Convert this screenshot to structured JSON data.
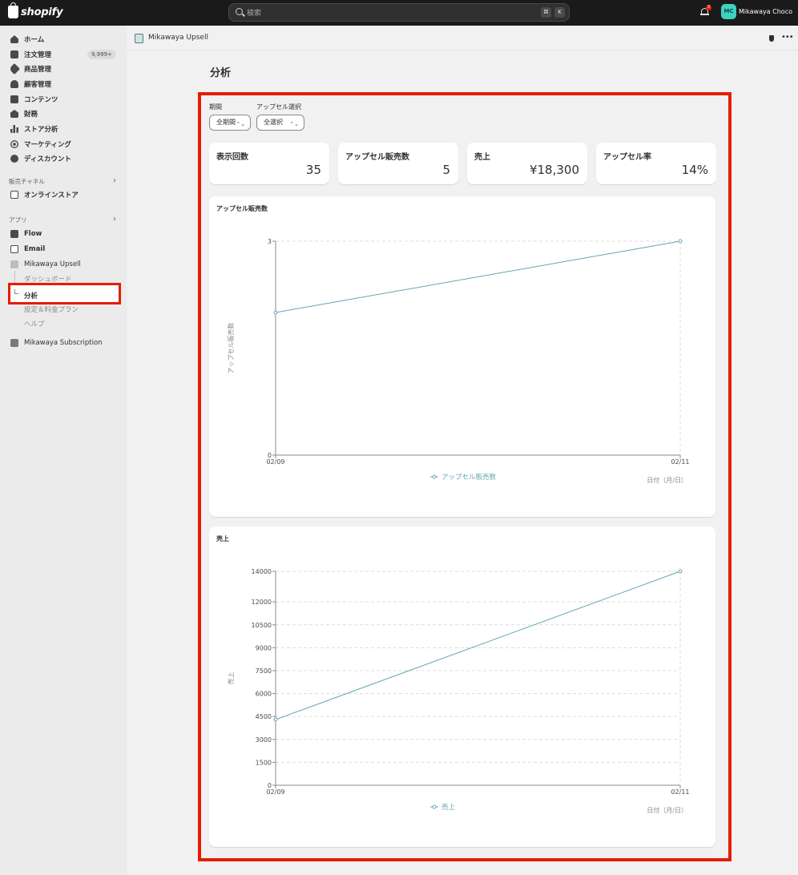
{
  "topbar": {
    "brand": "shopify",
    "search_placeholder": "検索",
    "kbd_cmd": "⌘",
    "kbd_k": "K",
    "notification_count": "3",
    "avatar_initials": "MC",
    "user_name": "Mikawaya Choco"
  },
  "sidebar": {
    "items": [
      {
        "label": "ホーム",
        "icon": "home-icon"
      },
      {
        "label": "注文管理",
        "icon": "orders-icon",
        "badge": "9,999+"
      },
      {
        "label": "商品管理",
        "icon": "tag-icon"
      },
      {
        "label": "顧客管理",
        "icon": "person-icon"
      },
      {
        "label": "コンテンツ",
        "icon": "content-icon"
      },
      {
        "label": "財務",
        "icon": "bank-icon"
      },
      {
        "label": "ストア分析",
        "icon": "bar-chart-icon"
      },
      {
        "label": "マーケティング",
        "icon": "target-icon"
      },
      {
        "label": "ディスカウント",
        "icon": "discount-icon"
      }
    ],
    "sales_channels_label": "販売チャネル",
    "online_store_label": "オンラインストア",
    "apps_label": "アプリ",
    "apps": [
      {
        "label": "Flow"
      },
      {
        "label": "Email"
      },
      {
        "label": "Mikawaya Upsell"
      }
    ],
    "upsell_sub": {
      "dashboard": "ダッシュボード",
      "analytics": "分析",
      "settings": "設定＆料金プラン",
      "help": "ヘルプ"
    },
    "subscription_label": "Mikawaya Subscription"
  },
  "main": {
    "app_name": "Mikawaya Upsell",
    "page_title": "分析",
    "filters": {
      "period_label": "期間",
      "period_value": "全期間",
      "upsell_label": "アップセル選択",
      "upsell_value": "全選択"
    },
    "kpis": [
      {
        "label": "表示回数",
        "value": "35"
      },
      {
        "label": "アップセル販売数",
        "value": "5"
      },
      {
        "label": "売上",
        "value": "¥18,300"
      },
      {
        "label": "アップセル率",
        "value": "14%"
      }
    ]
  },
  "colors": {
    "accent_line": "#5fa8b0",
    "highlight": "#e51c00",
    "avatar": "#3fd0c0"
  },
  "chart_data": [
    {
      "type": "line",
      "title": "アップセル販売数",
      "x": [
        "02/09",
        "02/11"
      ],
      "series": [
        {
          "name": "アップセル販売数",
          "values": [
            2,
            3
          ]
        }
      ],
      "ylabel": "アップセル販売数",
      "xlabel": "日付（月/日）",
      "yticks": [
        "0",
        "3"
      ],
      "ylim": [
        0,
        3
      ],
      "legend": "bottom"
    },
    {
      "type": "line",
      "title": "売上",
      "x": [
        "02/09",
        "02/11"
      ],
      "series": [
        {
          "name": "売上",
          "values": [
            4300,
            14000
          ]
        }
      ],
      "ylabel": "売上",
      "xlabel": "日付（月/日）",
      "yticks": [
        "0",
        "1500",
        "3000",
        "4500",
        "6000",
        "7500",
        "9000",
        "10500",
        "12000",
        "14000"
      ],
      "ylim": [
        0,
        14000
      ],
      "legend": "bottom"
    }
  ]
}
